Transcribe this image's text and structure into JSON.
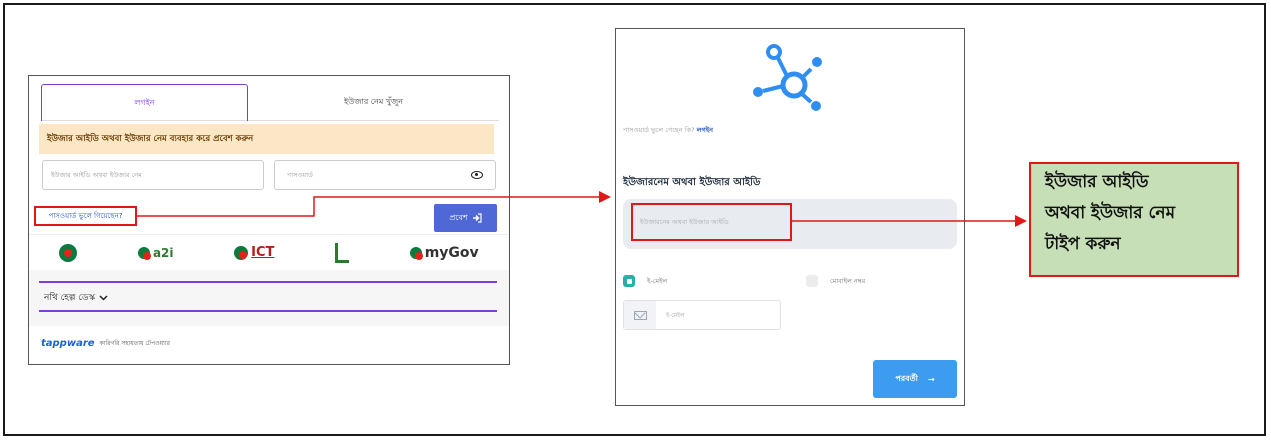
{
  "left_login": {
    "tabs": [
      {
        "label": "লগইন"
      },
      {
        "label": "ইউজার নেম খুঁজুন"
      }
    ],
    "info_banner": "ইউজার আইডি অথবা ইউজার নেম ব্যবহার করে প্রবেশ করুন",
    "userid_placeholder": "ইউজার আইডি অথবা ইউজার নেম",
    "password_placeholder": "পাসওয়ার্ড",
    "forgot_password": "পাসওয়ার্ড ভুলে গিয়েছেন?",
    "login_button": "প্রবেশ",
    "logos": {
      "a2i": "a2i",
      "ict": "ICT",
      "mygov": "myGov"
    },
    "help_desk": "নথি হেল্প ডেস্ক",
    "footer": {
      "brand": "tappware",
      "text": "কারিগরি সহায়তায় টেপওয়্যার"
    }
  },
  "right_form": {
    "forgot_line": "পাসওয়ার্ড ভুলে গেছেন কি?",
    "login_link": "লগইন",
    "username_label": "ইউজারনেম অথবা ইউজার আইডি",
    "username_placeholder": "ইউজারনেম অথবা ইউজার আইডি",
    "radio_email": "ই-মেইল",
    "radio_mobile": "মোবাইল নম্বর",
    "email_placeholder": "ই-মেইল",
    "next_button": "পরবর্তী",
    "next_arrow": "→"
  },
  "callout": {
    "text": "ইউজার আইডি\nঅথবা ইউজার নেম\nটাইপ করুন"
  },
  "colors": {
    "accent_purple": "#7b3ed8",
    "login_button": "#4f68d6",
    "next_button": "#3d9cf0",
    "annotation_red": "#e11818",
    "callout_green": "#c7dfb6"
  }
}
